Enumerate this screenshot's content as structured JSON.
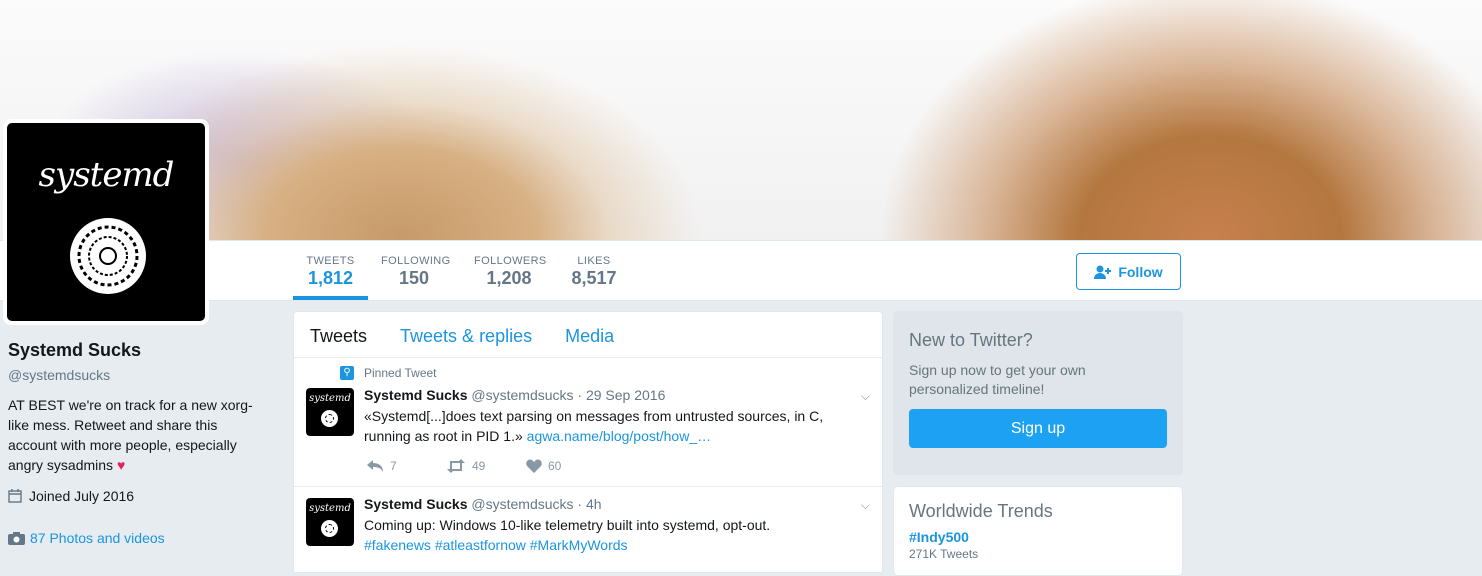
{
  "profile": {
    "name": "Systemd Sucks",
    "handle": "@systemdsucks",
    "bio": "AT BEST we're on track for a new xorg-like mess. Retweet and share this account with more people, especially angry sysadmins",
    "joined": "Joined July 2016",
    "photos": "87 Photos and videos",
    "logo_text": "systemd"
  },
  "stats": [
    {
      "label": "TWEETS",
      "value": "1,812"
    },
    {
      "label": "FOLLOWING",
      "value": "150"
    },
    {
      "label": "FOLLOWERS",
      "value": "1,208"
    },
    {
      "label": "LIKES",
      "value": "8,517"
    }
  ],
  "follow_label": "Follow",
  "tabs": [
    "Tweets",
    "Tweets & replies",
    "Media"
  ],
  "tweets": [
    {
      "pinned_label": "Pinned Tweet",
      "name": "Systemd Sucks",
      "meta": "@systemdsucks · 29 Sep 2016",
      "text": "«Systemd[...]does text parsing on messages from untrusted sources, in C, running as root in PID 1.»",
      "link": "agwa.name/blog/post/how_…",
      "replies": "7",
      "retweets": "49",
      "likes": "60"
    },
    {
      "name": "Systemd Sucks",
      "meta": "@systemdsucks · 4h",
      "text": "Coming up: Windows 10-like telemetry built into systemd, opt-out.",
      "hashtags": "#fakenews #atleastfornow #MarkMyWords"
    }
  ],
  "sidebar": {
    "new_title": "New to Twitter?",
    "new_sub": "Sign up now to get your own personalized timeline!",
    "signup_label": "Sign up",
    "trends_title": "Worldwide Trends",
    "trend_tag": "#Indy500",
    "trend_count": "271K Tweets"
  },
  "colors": {
    "accent": "#1b95e0",
    "signup": "#1da1f2",
    "heart": "#e0245e"
  }
}
